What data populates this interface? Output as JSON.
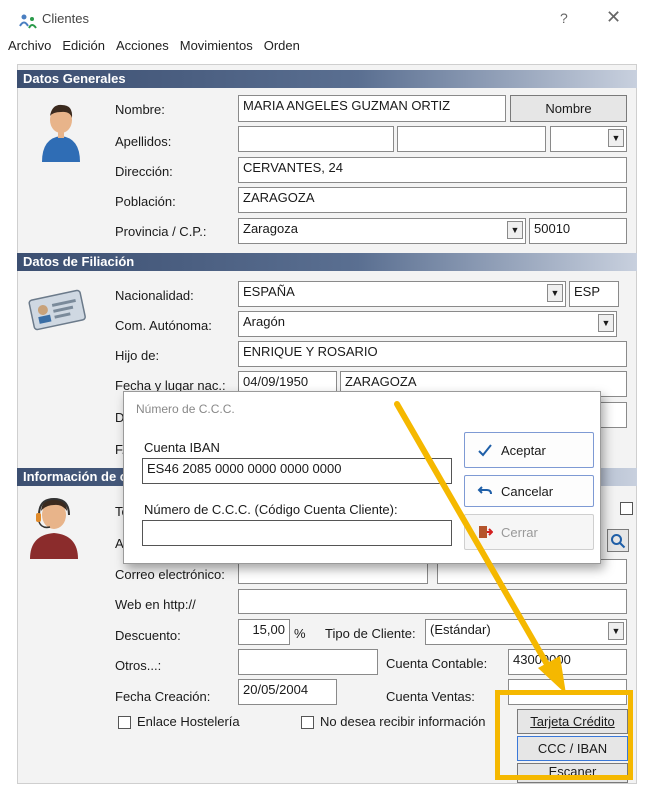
{
  "window": {
    "title": "Clientes",
    "help": "?",
    "close": "✕"
  },
  "menu": [
    "Archivo",
    "Edición",
    "Acciones",
    "Movimientos",
    "Orden"
  ],
  "sections": {
    "general": "Datos Generales",
    "filiacion": "Datos de Filiación",
    "informacion": "Información de c"
  },
  "general": {
    "nombre_label": "Nombre:",
    "nombre_value": "MARIA ANGELES GUZMAN ORTIZ",
    "nombre_button": "Nombre",
    "apellidos_label": "Apellidos:",
    "apellido1": "",
    "apellido2": "",
    "apellido_combo": "",
    "direccion_label": "Dirección:",
    "direccion_value": "CERVANTES, 24",
    "poblacion_label": "Población:",
    "poblacion_value": "ZARAGOZA",
    "provincia_label": "Provincia / C.P.:",
    "provincia_value": "Zaragoza",
    "cp_value": "50010"
  },
  "filiacion": {
    "nacionalidad_label": "Nacionalidad:",
    "nacionalidad_value": "ESPAÑA",
    "nacionalidad_code": "ESP",
    "comunidad_label": "Com. Autónoma:",
    "comunidad_value": "Aragón",
    "hijo_label": "Hijo de:",
    "hijo_value": "ENRIQUE Y ROSARIO",
    "fecha_lugar_label": "Fecha y lugar nac.:",
    "fecha_value": "04/09/1950",
    "lugar_value": "ZARAGOZA",
    "do_label": "Do",
    "fe_label": "F.E"
  },
  "informacion": {
    "tel_label": "Tel",
    "aq_label": "Aq",
    "correo_label": "Correo electrónico:",
    "web_label": "Web en http://",
    "descuento_label": "Descuento:",
    "descuento_value": "15,00",
    "percent": "%",
    "tipo_label": "Tipo de Cliente:",
    "tipo_value": "(Estándar)",
    "otros_label": "Otros...:",
    "cuenta_contable_label": "Cuenta Contable:",
    "cuenta_contable_value": "43000000",
    "fecha_creacion_label": "Fecha Creación:",
    "fecha_creacion_value": "20/05/2004",
    "cuenta_ventas_label": "Cuenta Ventas:",
    "enlace_label": "Enlace Hostelería",
    "no_desea_label": "No desea recibir información",
    "tarjeta_button": "Tarjeta Crédito",
    "ccc_button": "CCC / IBAN",
    "escaner_button": "Escaner"
  },
  "dialog": {
    "title": "Número de C.C.C.",
    "iban_label": "Cuenta IBAN",
    "iban_value": "ES46 2085 0000 0000 0000 0000",
    "ccc_label": "Número de C.C.C. (Código Cuenta Cliente):",
    "ccc_value": "",
    "aceptar": "Aceptar",
    "cancelar": "Cancelar",
    "cerrar": "Cerrar"
  },
  "colors": {
    "annotation": "#f5b800",
    "header_dark": "#3c4f71"
  }
}
